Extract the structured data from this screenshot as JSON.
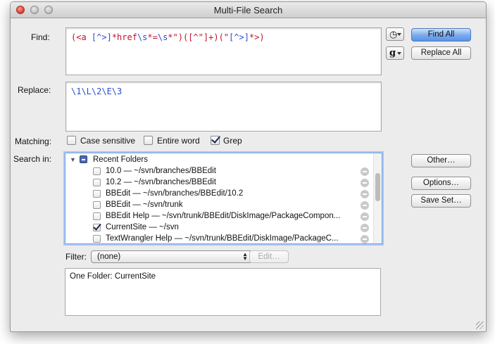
{
  "window": {
    "title": "Multi-File Search"
  },
  "find": {
    "label": "Find:",
    "tokens": [
      {
        "text": "(<a ",
        "color": "red"
      },
      {
        "text": "[^>]",
        "color": "blue"
      },
      {
        "text": "*href",
        "color": "red"
      },
      {
        "text": "\\s",
        "color": "blue"
      },
      {
        "text": "*=",
        "color": "red"
      },
      {
        "text": "\\s",
        "color": "blue"
      },
      {
        "text": "*\")",
        "color": "red"
      },
      {
        "text": "([^\"]+)",
        "color": "red"
      },
      {
        "text": "(\"",
        "color": "red"
      },
      {
        "text": "[^>]",
        "color": "blue"
      },
      {
        "text": "*>)",
        "color": "red"
      }
    ]
  },
  "replace": {
    "label": "Replace:",
    "value": "\\1\\L\\2\\E\\3"
  },
  "buttons": {
    "find_all": "Find All",
    "replace_all": "Replace All",
    "other": "Other…",
    "options": "Options…",
    "save_set": "Save Set…",
    "edit": "Edit…"
  },
  "icons": {
    "history": "clock-icon",
    "grep_menu": "g-icon"
  },
  "matching": {
    "label": "Matching:",
    "options": [
      {
        "label": "Case sensitive",
        "checked": false
      },
      {
        "label": "Entire word",
        "checked": false
      },
      {
        "label": "Grep",
        "checked": true
      }
    ]
  },
  "search_in": {
    "label": "Search in:",
    "group": "Recent Folders",
    "items": [
      {
        "label": "10.0 — ~/svn/branches/BBEdit",
        "checked": false
      },
      {
        "label": "10.2 — ~/svn/branches/BBEdit",
        "checked": false
      },
      {
        "label": "BBEdit — ~/svn/branches/BBEdit/10.2",
        "checked": false
      },
      {
        "label": "BBEdit — ~/svn/trunk",
        "checked": false
      },
      {
        "label": "BBEdit Help — ~/svn/trunk/BBEdit/DiskImage/PackageCompon...",
        "checked": false
      },
      {
        "label": "CurrentSite — ~/svn",
        "checked": true
      },
      {
        "label": "TextWrangler Help — ~/svn/trunk/BBEdit/DiskImage/PackageC...",
        "checked": false
      }
    ]
  },
  "filter": {
    "label": "Filter:",
    "value": "(none)"
  },
  "summary": "One Folder: CurrentSite"
}
